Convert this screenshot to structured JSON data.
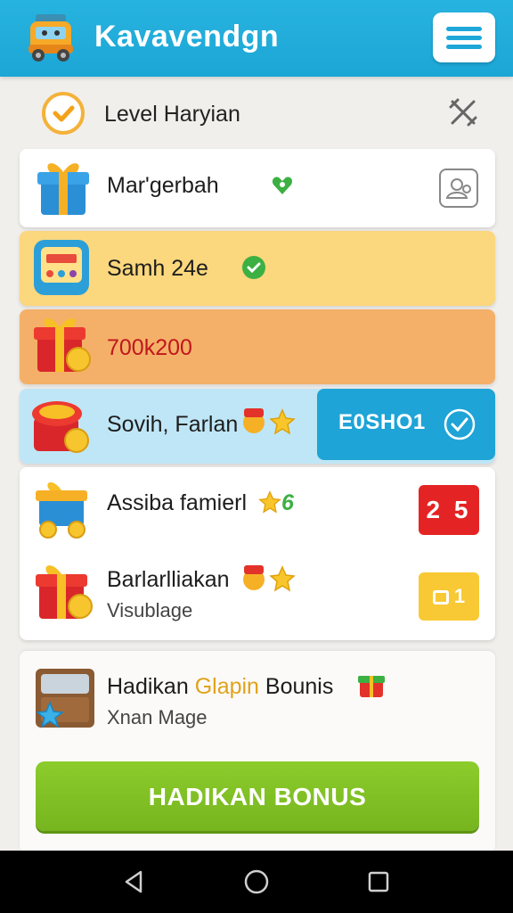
{
  "header": {
    "app_title": "Kavavendgn",
    "logo_icon": "car-mascot-icon",
    "menu_icon": "hamburger-menu-icon"
  },
  "level": {
    "title": "Level Haryian",
    "check_icon": "check-circle-icon",
    "close_icon": "close-icon"
  },
  "rows": [
    {
      "title": "Mar'gerbah",
      "icon": "gift-box-icon",
      "badge_icon": "green-heart-icon",
      "action_icon": "profile-card-icon"
    },
    {
      "title": "Samh 24e",
      "icon": "slot-machine-icon",
      "badge_icon": "green-check-icon"
    },
    {
      "title": "700k200",
      "icon": "gift-coin-icon"
    },
    {
      "title": "Sovih, Farlan",
      "icon": "treasure-box-icon",
      "emoji_icons": [
        "gift-emoji-icon",
        "star-icon"
      ],
      "bonus_label": "E0SHO1",
      "bonus_icon": "check-circle-icon"
    }
  ],
  "list": [
    {
      "title": "Assiba famierl",
      "icon": "gift-cart-icon",
      "suffix_icon": "star-icon",
      "suffix_text": "6",
      "badge": "2 5",
      "badge_color": "#e42424"
    },
    {
      "title": "Barlarlliakan",
      "subtitle": "Visublage",
      "icon": "gift-coin-icon",
      "emoji_icons": [
        "gift-emoji-icon",
        "star-icon"
      ],
      "badge": "1",
      "badge_color": "#f8c934"
    }
  ],
  "bonus_card": {
    "title_prefix": "Hadikan",
    "title_highlight": "Glapin",
    "title_suffix": "Bounis",
    "subtitle": "Xnan Mage",
    "icon": "treasure-chest-icon",
    "gift_icon": "gift-emoji-icon"
  },
  "cta": {
    "label": "HADIKAN BONUS"
  },
  "colors": {
    "header": "#1ca6d6",
    "row_yellow": "#fbd77d",
    "row_orange": "#f4b068",
    "row_blue": "#bfe6f6",
    "bonus_pill": "#1ea4d6",
    "cta_green": "#7bbd20"
  },
  "navbar": {
    "icons": [
      "back-icon",
      "home-icon",
      "recents-icon"
    ]
  }
}
